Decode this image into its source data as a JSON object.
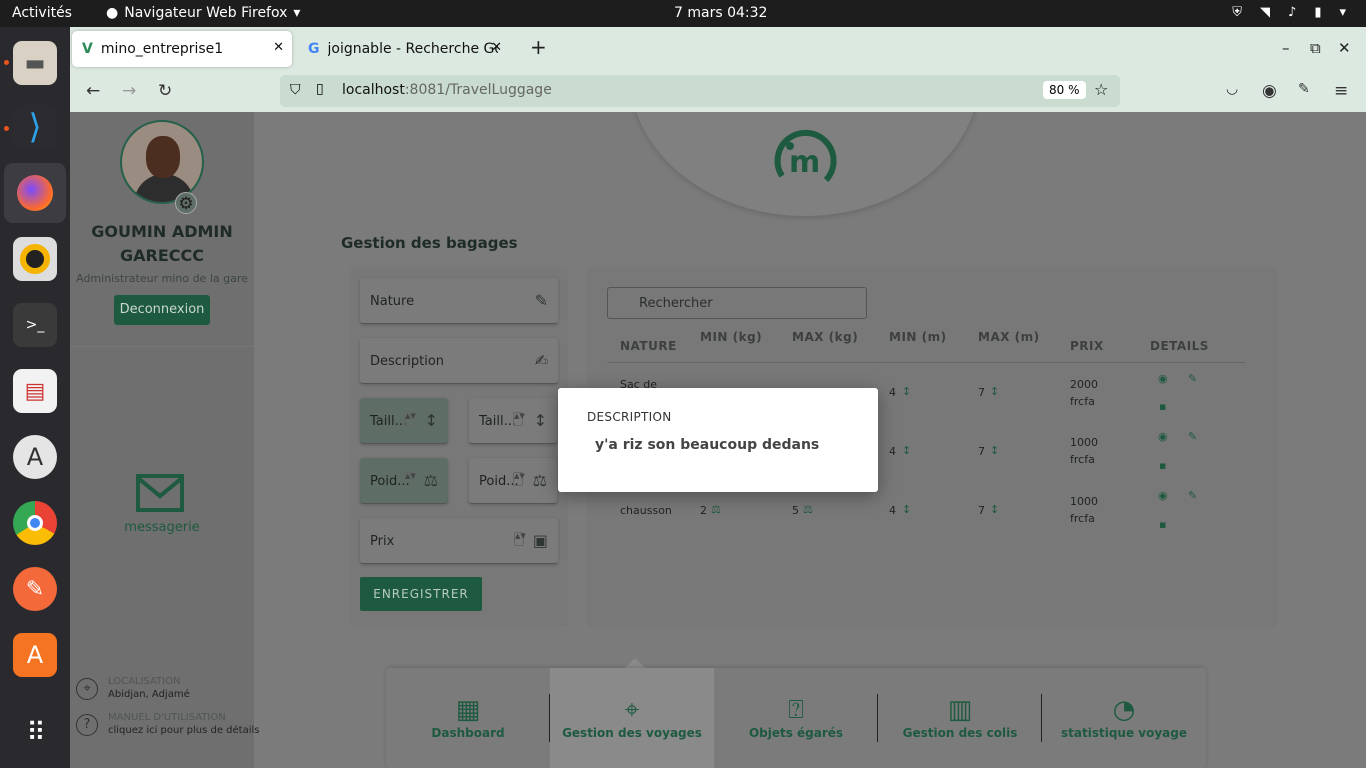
{
  "os": {
    "activities": "Activités",
    "app_name": "Navigateur Web Firefox",
    "clock": "7 mars  04:32"
  },
  "browser": {
    "tabs": [
      {
        "title": "mino_entreprise1"
      },
      {
        "title": "joignable - Recherche Go"
      }
    ],
    "url_host": "localhost",
    "url_rest": ":8081/TravelLuggage",
    "zoom": "80 %"
  },
  "sidebar": {
    "user_name": "GOUMIN ADMIN GARECCC",
    "user_role": "Administrateur mino de la gare",
    "logout_label": "Deconnexion",
    "messaging_label": "messagerie",
    "location_title": "LOCALISATION",
    "location_value": "Abidjan, Adjamé",
    "manual_title": "MANUEL D'UTILISATION",
    "manual_value": "cliquez ici pour plus de détails"
  },
  "main": {
    "title": "Gestion des bagages",
    "form": {
      "nature": "Nature",
      "description": "Description",
      "size_min": "Taill...",
      "size_max": "Taill...",
      "weight_min": "Poid...",
      "weight_max": "Poid...",
      "price": "Prix",
      "save": "ENREGISTRER"
    },
    "search_placeholder": "Rechercher",
    "table": {
      "headers": [
        "NATURE",
        "MIN (kg)",
        "MAX (kg)",
        "MIN (m)",
        "MAX (m)",
        "PRIX",
        "DETAILS"
      ],
      "rows": [
        {
          "nature": "Sac de",
          "min_kg": "",
          "max_kg": "",
          "min_m": "4",
          "max_m": "7",
          "prix1": "2000",
          "prix2": "frcfa"
        },
        {
          "nature": "",
          "min_kg": "",
          "max_kg": "",
          "min_m": "4",
          "max_m": "7",
          "prix1": "1000",
          "prix2": "frcfa"
        },
        {
          "nature": "chausson",
          "min_kg": "2",
          "max_kg": "5",
          "min_m": "4",
          "max_m": "7",
          "prix1": "1000",
          "prix2": "frcfa"
        }
      ]
    }
  },
  "bottom_nav": [
    {
      "label": "Dashboard"
    },
    {
      "label": "Gestion des voyages"
    },
    {
      "label": "Objets égarés"
    },
    {
      "label": "Gestion des colis"
    },
    {
      "label": "statistique voyage"
    }
  ],
  "modal": {
    "title": "DESCRIPTION",
    "body": "y'a riz son beaucoup dedans"
  }
}
